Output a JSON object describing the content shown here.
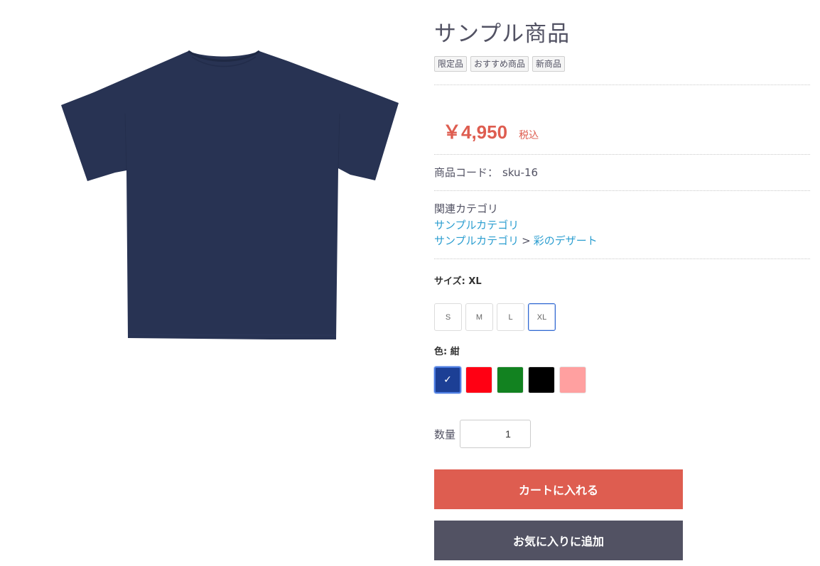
{
  "product": {
    "title": "サンプル商品",
    "tags": [
      "限定品",
      "おすすめ商品",
      "新商品"
    ],
    "price": "￥4,950",
    "tax_label": "税込",
    "code_label": "商品コード：",
    "code_value": "sku-16",
    "category_heading": "関連カテゴリ",
    "category_link_1": "サンプルカテゴリ",
    "category_link_2": "サンプルカテゴリ",
    "category_separator": ">",
    "category_link_3": "彩のデザート",
    "image_icon": "tshirt-image",
    "shirt_color": "#283353"
  },
  "options": {
    "size_label": "サイズ: XL",
    "sizes": [
      "S",
      "M",
      "L",
      "XL"
    ],
    "selected_size": "XL",
    "color_label": "色: 紺",
    "colors": [
      "#1c3f95",
      "#ff0013",
      "#128220",
      "#000000",
      "#ffa0a0"
    ],
    "selected_color_check": "✓"
  },
  "quantity": {
    "label": "数量",
    "value": "1"
  },
  "actions": {
    "cart_label": "カートに入れる",
    "favorite_label": "お気に入りに追加"
  },
  "colors": {
    "accent": "#de5d50",
    "link": "#2c9ed0",
    "dark_button": "#525263"
  }
}
